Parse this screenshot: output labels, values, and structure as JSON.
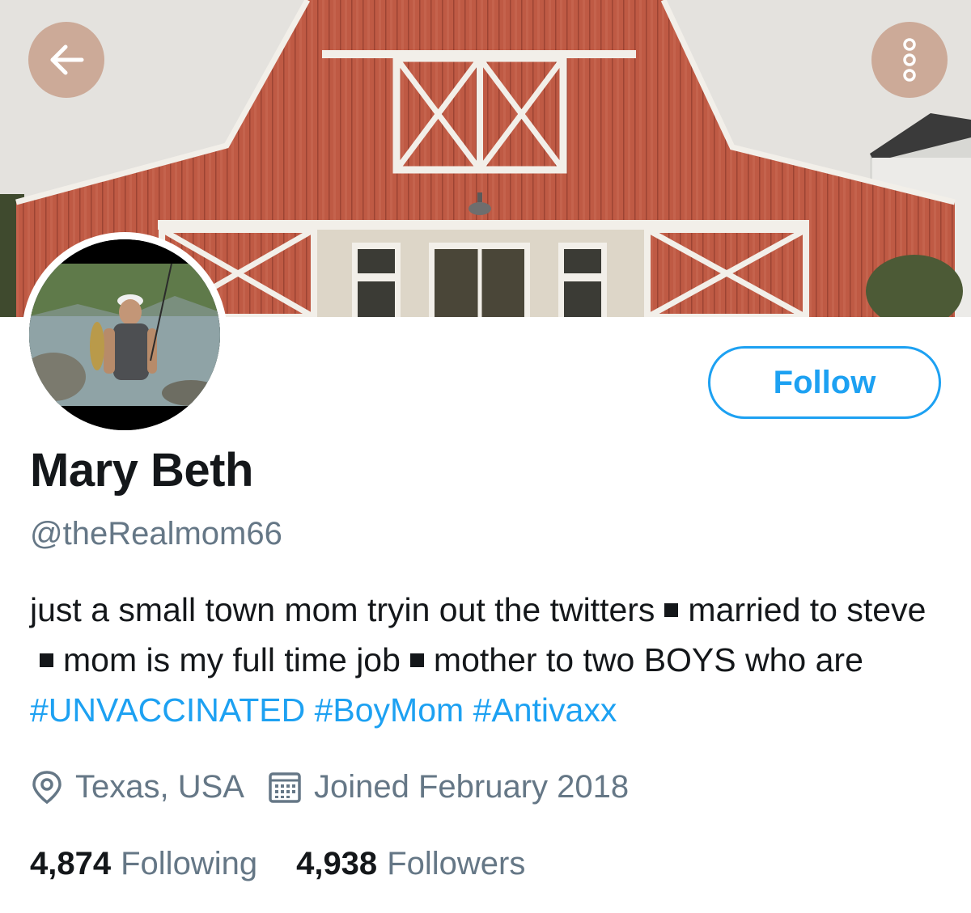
{
  "profile": {
    "name": "Mary Beth",
    "handle": "@theRealmom66",
    "follow_label": "Follow"
  },
  "bio": {
    "segment_1": "just a small town mom tryin out the twitters",
    "segment_2": "married to steve",
    "segment_3": "mom is my full time job",
    "segment_4": "mother to two BOYS who are",
    "hashtags": [
      "#UNVACCINATED",
      "#BoyMom",
      "#Antivaxx"
    ]
  },
  "meta": {
    "location": "Texas, USA",
    "joined": "Joined February 2018",
    "location_icon": "location-pin-icon",
    "joined_icon": "calendar-icon"
  },
  "stats": {
    "following_count": "4,874",
    "following_label": "Following",
    "followers_count": "4,938",
    "followers_label": "Followers"
  },
  "colors": {
    "accent": "#1da1f2",
    "text_primary": "#14171a",
    "text_secondary": "#657786",
    "barn_red": "#b5503d"
  }
}
